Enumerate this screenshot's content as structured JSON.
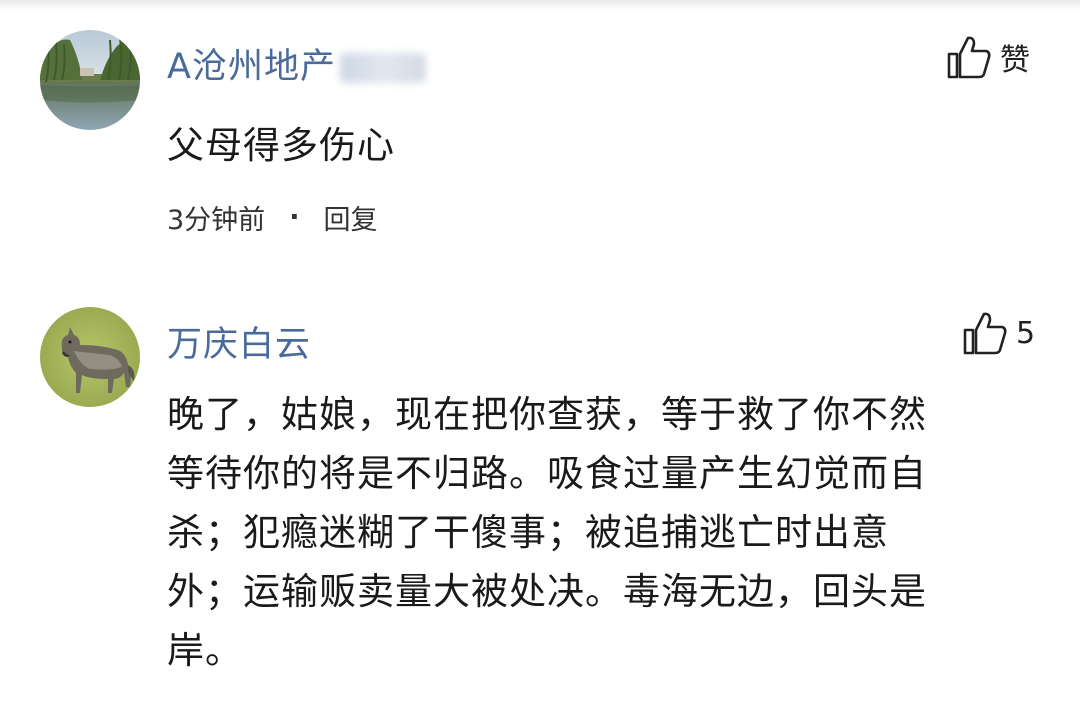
{
  "comments": [
    {
      "username": "A沧州地产",
      "username_obscured": true,
      "avatar": "lake-willow-photo",
      "like_label": "赞",
      "content": "父母得多伤心",
      "time": "3分钟前",
      "separator": "·",
      "reply_label": "回复"
    },
    {
      "username": "万庆白云",
      "avatar": "wolf-on-grass-photo",
      "like_count": "5",
      "content": "晚了，姑娘，现在把你查获，等于救了你不然等待你的将是不归路。吸食过量产生幻觉而自杀；犯瘾迷糊了干傻事；被追捕逃亡时出意外；运输贩卖量大被处决。毒海无边，回头是岸。",
      "content_lines": [
        "晚了，姑娘，现在把你查获，等于救了你不然",
        "等待你的将是不归路。吸食过量产生幻觉而自",
        "杀；犯瘾迷糊了干傻事；被追捕逃亡时出意",
        "外；运输贩卖量大被处决。毒海无边，回头是",
        "岸。"
      ]
    }
  ],
  "colors": {
    "username": "#4a6b9a",
    "text": "#1a1a1a",
    "meta": "#333333"
  },
  "icons": {
    "like": "thumbs-up-icon"
  }
}
